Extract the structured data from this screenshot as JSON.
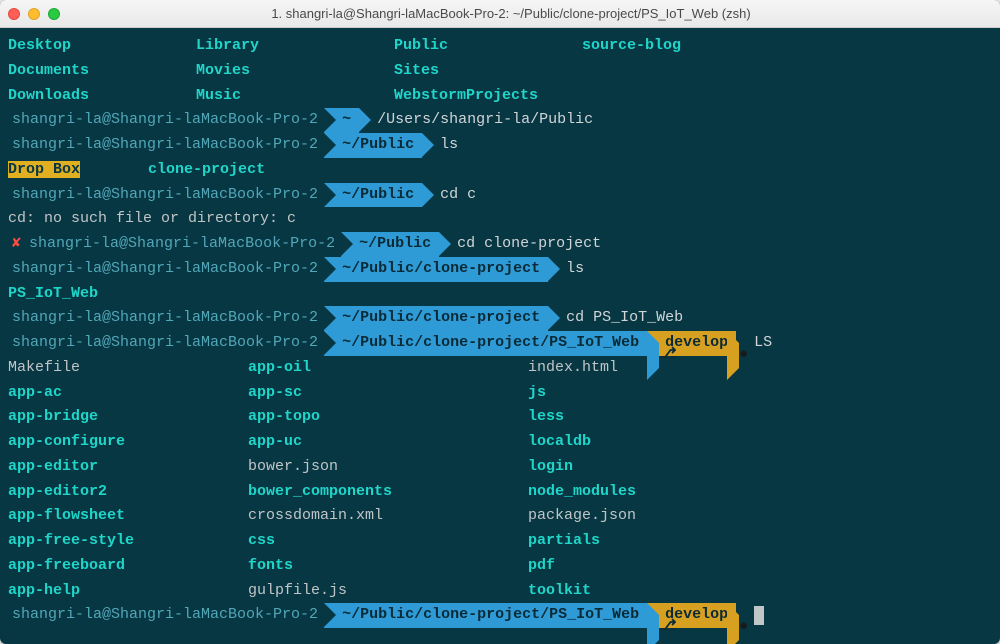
{
  "window": {
    "title": "1. shangri-la@Shangri-laMacBook-Pro-2: ~/Public/clone-project/PS_IoT_Web (zsh)"
  },
  "host": "shangri-la@Shangri-laMacBook-Pro-2",
  "ls_home": {
    "col1": [
      "Desktop",
      "Documents",
      "Downloads"
    ],
    "col2": [
      "Library",
      "Movies",
      "Music"
    ],
    "col3": [
      "Public",
      "Sites",
      "WebstormProjects"
    ],
    "col4": [
      "source-blog"
    ]
  },
  "prompt1": {
    "path": "~",
    "cmd": "/Users/shangri-la/Public"
  },
  "prompt2": {
    "path": "~/Public",
    "cmd": "ls"
  },
  "ls_public": {
    "a": "Drop Box",
    "b": "clone-project"
  },
  "prompt3": {
    "path": "~/Public",
    "cmd": "cd c"
  },
  "err": "cd: no such file or directory: c",
  "prompt4": {
    "path": "~/Public",
    "cmd": "cd clone-project"
  },
  "prompt5": {
    "path": "~/Public/clone-project",
    "cmd": "ls"
  },
  "ls_clone": "PS_IoT_Web",
  "prompt6": {
    "path": "~/Public/clone-project",
    "cmd": "cd PS_IoT_Web"
  },
  "prompt7": {
    "path": "~/Public/clone-project/PS_IoT_Web",
    "branch": "develop",
    "cmd": "LS"
  },
  "ls_project": {
    "col1": [
      "Makefile",
      "app-ac",
      "app-bridge",
      "app-configure",
      "app-editor",
      "app-editor2",
      "app-flowsheet",
      "app-free-style",
      "app-freeboard",
      "app-help"
    ],
    "col2": [
      "app-oil",
      "app-sc",
      "app-topo",
      "app-uc",
      "bower.json",
      "bower_components",
      "crossdomain.xml",
      "css",
      "fonts",
      "gulpfile.js"
    ],
    "col3": [
      "index.html",
      "js",
      "less",
      "localdb",
      "login",
      "node_modules",
      "package.json",
      "partials",
      "pdf",
      "toolkit"
    ]
  },
  "prompt8": {
    "path": "~/Public/clone-project/PS_IoT_Web",
    "branch": "develop"
  },
  "dir_types": {
    "project_dirs": [
      "app-ac",
      "app-bridge",
      "app-configure",
      "app-editor",
      "app-editor2",
      "app-flowsheet",
      "app-free-style",
      "app-freeboard",
      "app-help",
      "app-oil",
      "app-sc",
      "app-topo",
      "app-uc",
      "bower_components",
      "css",
      "fonts",
      "js",
      "less",
      "localdb",
      "login",
      "node_modules",
      "partials",
      "pdf",
      "toolkit"
    ]
  }
}
